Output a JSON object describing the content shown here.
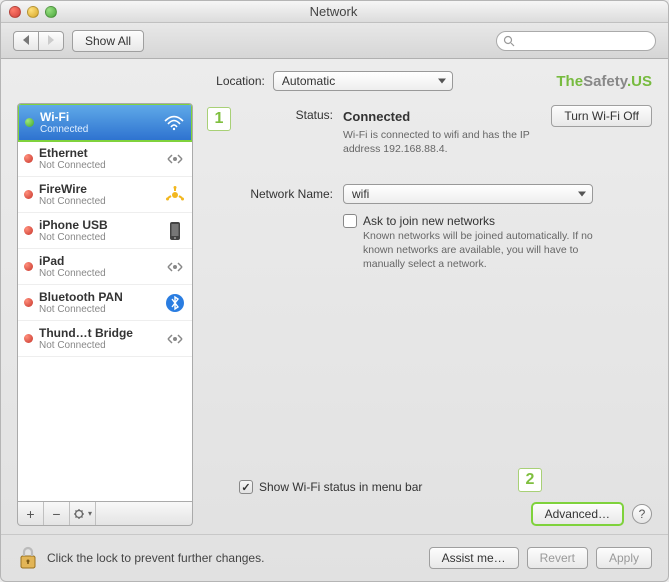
{
  "window_title": "Network",
  "toolbar": {
    "show_all": "Show All",
    "search_placeholder": ""
  },
  "location": {
    "label": "Location:",
    "value": "Automatic"
  },
  "brand": {
    "t1": "The",
    "t2": "Safety",
    "t3": ".US"
  },
  "services": [
    {
      "name": "Wi-Fi",
      "sub": "Connected",
      "status": "green",
      "icon": "wifi",
      "selected": true
    },
    {
      "name": "Ethernet",
      "sub": "Not Connected",
      "status": "red",
      "icon": "ethernet",
      "selected": false
    },
    {
      "name": "FireWire",
      "sub": "Not Connected",
      "status": "red",
      "icon": "firewire",
      "selected": false
    },
    {
      "name": "iPhone USB",
      "sub": "Not Connected",
      "status": "red",
      "icon": "iphone",
      "selected": false
    },
    {
      "name": "iPad",
      "sub": "Not Connected",
      "status": "red",
      "icon": "ethernet",
      "selected": false
    },
    {
      "name": "Bluetooth PAN",
      "sub": "Not Connected",
      "status": "red",
      "icon": "bluetooth",
      "selected": false
    },
    {
      "name": "Thund…t Bridge",
      "sub": "Not Connected",
      "status": "red",
      "icon": "ethernet",
      "selected": false
    }
  ],
  "callouts": {
    "c1": "1",
    "c2": "2"
  },
  "detail": {
    "status_label": "Status:",
    "status_value": "Connected",
    "turn_off": "Turn Wi-Fi Off",
    "status_desc": "Wi-Fi is connected to wifi and has the IP address 192.168.88.4.",
    "network_name_label": "Network Name:",
    "network_name_value": "wifi",
    "ask_label": "Ask to join new networks",
    "ask_desc": "Known networks will be joined automatically. If no known networks are available, you will have to manually select a network.",
    "show_status_label": "Show Wi-Fi status in menu bar",
    "advanced": "Advanced…"
  },
  "footer": {
    "lock_text": "Click the lock to prevent further changes.",
    "assist": "Assist me…",
    "revert": "Revert",
    "apply": "Apply"
  }
}
